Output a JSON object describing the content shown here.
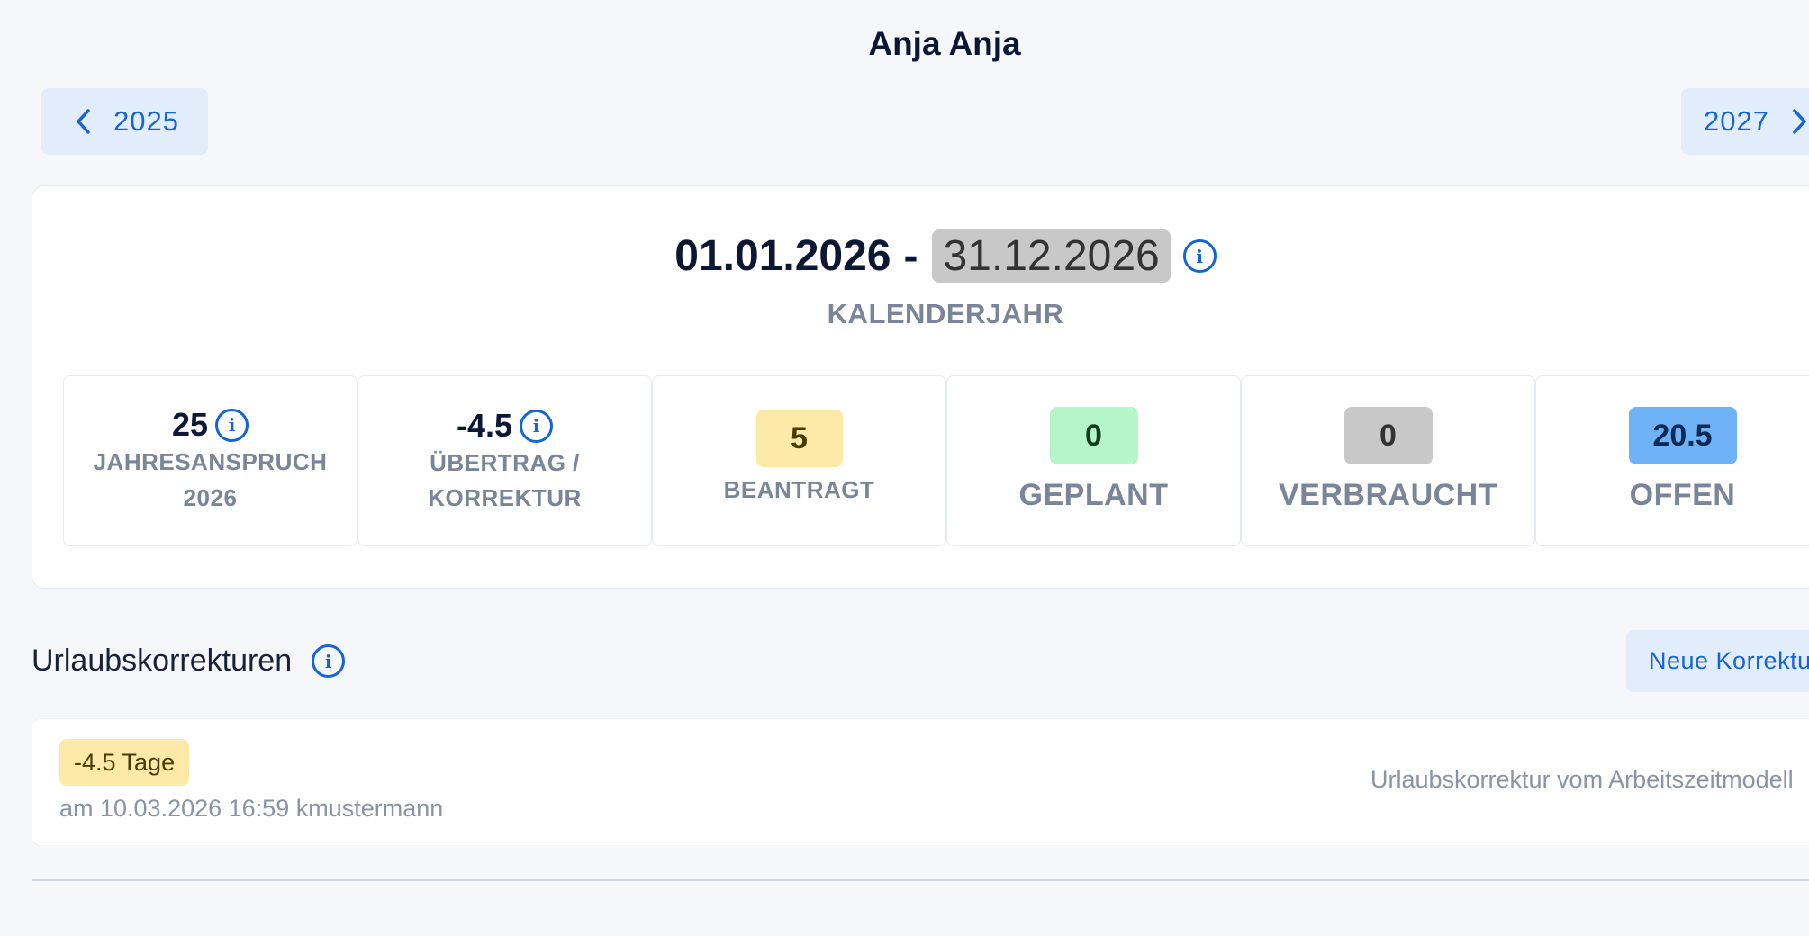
{
  "page": {
    "title": "Anja Anja"
  },
  "nav": {
    "prev_year": "2025",
    "next_year": "2027"
  },
  "period": {
    "start": "01.01.2026",
    "separator": "-",
    "end": "31.12.2026",
    "label": "KALENDERJAHR"
  },
  "stats": {
    "entitlement": {
      "value": "25",
      "label_line1": "JAHRESANSPRUCH",
      "label_line2": "2026"
    },
    "carryover": {
      "value": "-4.5",
      "label_line1": "ÜBERTRAG /",
      "label_line2": "KORREKTUR"
    },
    "requested": {
      "value": "5",
      "label": "BEANTRAGT",
      "color": "#fdeaa8"
    },
    "planned": {
      "value": "0",
      "label": "GEPLANT",
      "color": "#b6f5c8"
    },
    "used": {
      "value": "0",
      "label": "VERBRAUCHT",
      "color": "#c8c8c8"
    },
    "open": {
      "value": "20.5",
      "label": "OFFEN",
      "color": "#6fb2f5"
    }
  },
  "corrections": {
    "title": "Urlaubskorrekturen",
    "new_button": "Neue Korrektur",
    "items": [
      {
        "amount": "-4.5 Tage",
        "meta": "am 10.03.2026 16:59 kmustermann",
        "description": "Urlaubskorrektur vom Arbeitszeitmodell"
      }
    ]
  },
  "colors": {
    "accent": "#1565d8",
    "background": "#f5f7fb"
  },
  "icons": {
    "info": "info-icon",
    "prev": "chevron-left-icon",
    "next": "chevron-right-icon"
  }
}
